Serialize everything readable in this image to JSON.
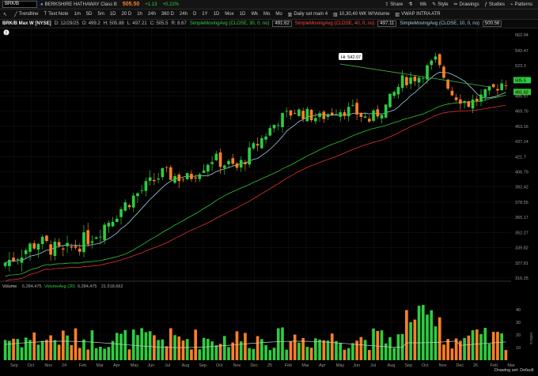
{
  "top": {
    "symbol": "BRK/B",
    "company": "BERKSHIRE HATHAWAY Class B",
    "price": "505.50",
    "change": "+1.13",
    "change_pct": "+0.22%",
    "share": "Share",
    "style": "Style",
    "studies": "Studies",
    "patterns": "Patterns",
    "wk": "Wk"
  },
  "toolbar": {
    "trendline": "Trendline",
    "textnote": "Text Note",
    "timeframes": [
      "1m",
      "5D",
      "5m",
      "1D",
      "20 D",
      "1h",
      "24h",
      "360 D",
      "24h",
      "D",
      "1Y",
      "1D"
    ],
    "ranges": [
      "Mox",
      "1D",
      "Wk",
      "Mo",
      "Mo"
    ],
    "daily_set": "Daily set main 4",
    "ema_preset": "10,30,40 WK W/Volume",
    "vwap": "VWAP INTRA ATR",
    "drawings": "Drawings"
  },
  "info": {
    "title": "BRK/B Max W [NYSE]",
    "date": "D: 12/29/25",
    "open": "O: 499.2",
    "high": "H: 505.88",
    "low": "L: 497.21",
    "close": "C: 505.5",
    "range": "R: 8.67",
    "sma30": "SimpleMovingAvg (CLOSE, 30, 0, no)",
    "sma30_val": "491.62",
    "sma40": "SimpleMovingAvg (CLOSE, 40, 0, no)",
    "sma40_val": "497.11",
    "sma10": "SimpleMovingAvg (CLOSE, 10, 0, no)",
    "sma10_val": "500.56"
  },
  "volume_label": "Volume",
  "volume_val": "6,284,475",
  "volavg_label": "VolumeAvg (20)",
  "volavg_val": "6,284,475",
  "volavg_2": "21,518,662",
  "high_callout": "Hi: 542.07",
  "price_ticks": [
    "562.94",
    "542.47",
    "523.3",
    "505.5",
    "491.62",
    "486.97",
    "469.76",
    "453.16",
    "437.14",
    "421.7",
    "406.79",
    "392.42",
    "378.55",
    "365.17",
    "352.27",
    "339.82",
    "327.81",
    "316.25"
  ],
  "volume_ticks": [
    "40",
    "30",
    "20",
    "10"
  ],
  "volume_axis_label": "Millions",
  "x_labels": [
    "Sep",
    "Oct",
    "Nov",
    "24",
    "Feb",
    "Mar",
    "Apr",
    "May",
    "Jun",
    "Jul",
    "Aug",
    "Sep",
    "Oct",
    "Nov",
    "Dec",
    "25",
    "Feb",
    "Mar",
    "Apr",
    "May",
    "Jun",
    "Jul",
    "Aug",
    "Sep",
    "Oct",
    "Nov",
    "Dec",
    "26",
    "Feb",
    "Mar"
  ],
  "footer": "Drawing set: Default",
  "colors": {
    "up": "#2ecc40",
    "down": "#ff7f27",
    "sma10": "#9ecbe0",
    "sma30": "#35c235",
    "sma40": "#e03030",
    "trend": "#3fbf3f"
  }
}
